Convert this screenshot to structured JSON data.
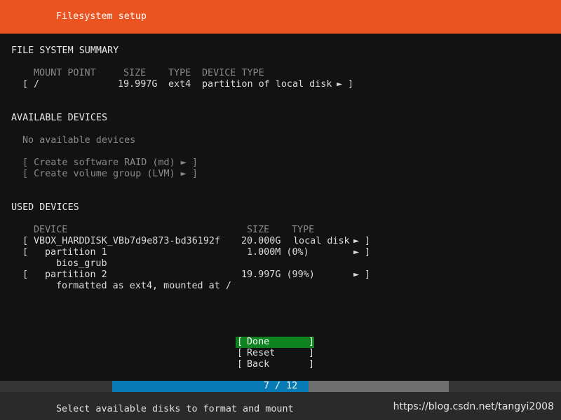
{
  "header": {
    "title": "Filesystem setup"
  },
  "summary": {
    "title": "FILE SYSTEM SUMMARY",
    "columns": {
      "mount": "MOUNT POINT",
      "size": "SIZE",
      "type": "TYPE",
      "device_type": "DEVICE TYPE"
    },
    "row": {
      "open": "[",
      "mount": "/",
      "size": "19.997G",
      "type": "ext4",
      "device_type": "partition of local disk",
      "arrow": "►",
      "close": "]"
    }
  },
  "available": {
    "title": "AVAILABLE DEVICES",
    "empty": "No available devices",
    "raid": "[ Create software RAID (md) ► ]",
    "lvm": "[ Create volume group (LVM) ► ]"
  },
  "used": {
    "title": "USED DEVICES",
    "columns": {
      "device": "DEVICE",
      "size": "SIZE",
      "type": "TYPE"
    },
    "disk": {
      "open": "[",
      "name": "VBOX_HARDDISK_VBb7d9e873-bd36192f",
      "size": "20.000G",
      "type": "local disk",
      "arrow": "►",
      "close": "]"
    },
    "partition1": {
      "open": "[",
      "name": "partition 1",
      "size": "1.000M (0%)",
      "arrow": "►",
      "close": "]",
      "detail": "bios_grub"
    },
    "partition2": {
      "open": "[",
      "name": "partition 2",
      "size": "19.997G (99%)",
      "arrow": "►",
      "close": "]",
      "detail": "formatted as ext4, mounted at /"
    }
  },
  "buttons": {
    "done": {
      "open": "[",
      "label": "Done",
      "close": "]"
    },
    "reset": {
      "open": "[",
      "label": "Reset",
      "close": "]"
    },
    "back": {
      "open": "[",
      "label": "Back",
      "close": "]"
    }
  },
  "progress": {
    "text": "7 / 12",
    "fraction": 0.583
  },
  "status": {
    "text": "Select available disks to format and mount"
  },
  "watermark": "https://blog.csdn.net/tangyi2008",
  "colors": {
    "header": "#e95420",
    "focus": "#0e8420",
    "progress": "#0779b4",
    "background": "#121212"
  }
}
